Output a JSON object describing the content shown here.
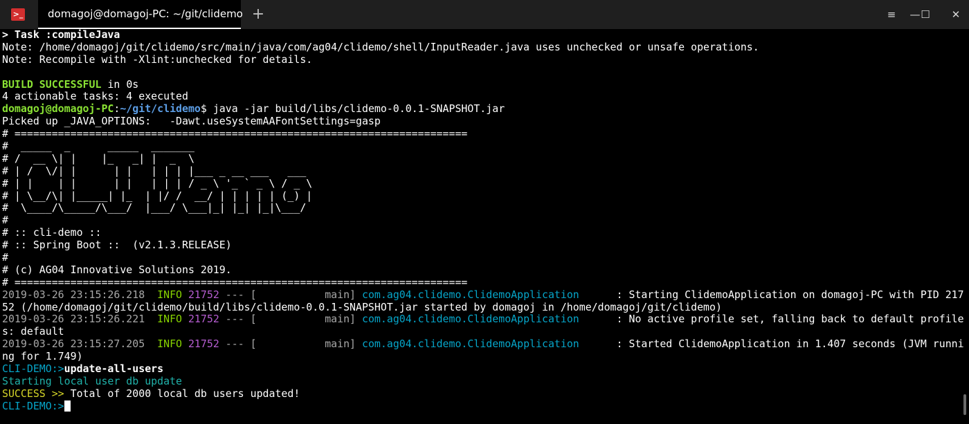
{
  "window": {
    "tab_title": "domagoj@domagoj-PC: ~/git/clidemo",
    "app_icon_glyph": ">_",
    "new_tab_glyph": "+",
    "controls": {
      "menu": "≡",
      "minimize": "—",
      "maximize": "☐",
      "close": "✕"
    }
  },
  "colors": {
    "default": "#ffffff",
    "green": "#8ae234",
    "blue": "#5c9ee6",
    "cyan": "#06a5c9",
    "grey": "#a8a8a8",
    "teal": "#20b2aa",
    "yellow": "#d5d528",
    "log_green": "#87d300",
    "pid_purple": "#b55dd0"
  },
  "terminal": {
    "lines": [
      [
        {
          "t": "> Task :compileJava",
          "c": "default",
          "b": true
        }
      ],
      [
        {
          "t": "Note: /home/domagoj/git/clidemo/src/main/java/com/ag04/clidemo/shell/InputReader.java uses unchecked or unsafe operations."
        }
      ],
      [
        {
          "t": "Note: Recompile with -Xlint:unchecked for details."
        }
      ],
      [
        {
          "t": ""
        }
      ],
      [
        {
          "t": "BUILD SUCCESSFUL",
          "c": "green",
          "b": true
        },
        {
          "t": " in 0s"
        }
      ],
      [
        {
          "t": "4 actionable tasks: 4 executed"
        }
      ],
      [
        {
          "t": "domagoj@domagoj-PC",
          "c": "green",
          "b": true
        },
        {
          "t": ":"
        },
        {
          "t": "~/git/clidemo",
          "c": "blue",
          "b": true
        },
        {
          "t": "$ java -jar build/libs/clidemo-0.0.1-SNAPSHOT.jar"
        }
      ],
      [
        {
          "t": "Picked up _JAVA_OPTIONS:   -Dawt.useSystemAAFontSettings=gasp"
        }
      ],
      [
        {
          "t": "# ========================================================================="
        }
      ],
      [
        {
          "t": "#  _____  _      _____  _______"
        }
      ],
      [
        {
          "t": "# /  __ \\| |    |_   _| |  _  \\"
        }
      ],
      [
        {
          "t": "# | /  \\/| |      | |   | | | |___ _ __ ___   ___"
        }
      ],
      [
        {
          "t": "# | |    | |      | |   | | | / _ \\ '_ ` _ \\ / _ \\"
        }
      ],
      [
        {
          "t": "# | \\__/\\| |_____| |_  | |/ /  __/ | | | | | (_) |"
        }
      ],
      [
        {
          "t": "#  \\____/\\_____/\\___/  |___/ \\___|_| |_| |_|\\___/"
        }
      ],
      [
        {
          "t": "#"
        }
      ],
      [
        {
          "t": "# :: cli-demo ::"
        }
      ],
      [
        {
          "t": "# :: Spring Boot ::  (v2.1.3.RELEASE)"
        }
      ],
      [
        {
          "t": "#"
        }
      ],
      [
        {
          "t": "# (c) AG04 Innovative Solutions 2019."
        }
      ],
      [
        {
          "t": "# ========================================================================="
        }
      ],
      [
        {
          "t": "2019-03-26 23:15:26.218",
          "c": "grey"
        },
        {
          "t": "  INFO",
          "c": "log_green"
        },
        {
          "t": " 21752",
          "c": "pid_purple"
        },
        {
          "t": " --- [           main]",
          "c": "grey"
        },
        {
          "t": " com.ag04.clidemo.ClidemoApplication",
          "c": "cyan"
        },
        {
          "t": "      : Starting ClidemoApplication on domagoj-PC with PID 217"
        }
      ],
      [
        {
          "t": "52 (/home/domagoj/git/clidemo/build/libs/clidemo-0.0.1-SNAPSHOT.jar started by domagoj in /home/domagoj/git/clidemo)"
        }
      ],
      [
        {
          "t": "2019-03-26 23:15:26.221",
          "c": "grey"
        },
        {
          "t": "  INFO",
          "c": "log_green"
        },
        {
          "t": " 21752",
          "c": "pid_purple"
        },
        {
          "t": " --- [           main]",
          "c": "grey"
        },
        {
          "t": " com.ag04.clidemo.ClidemoApplication",
          "c": "cyan"
        },
        {
          "t": "      : No active profile set, falling back to default profile"
        }
      ],
      [
        {
          "t": "s: default"
        }
      ],
      [
        {
          "t": "2019-03-26 23:15:27.205",
          "c": "grey"
        },
        {
          "t": "  INFO",
          "c": "log_green"
        },
        {
          "t": " 21752",
          "c": "pid_purple"
        },
        {
          "t": " --- [           main]",
          "c": "grey"
        },
        {
          "t": " com.ag04.clidemo.ClidemoApplication",
          "c": "cyan"
        },
        {
          "t": "      : Started ClidemoApplication in 1.407 seconds (JVM runni"
        }
      ],
      [
        {
          "t": "ng for 1.749)"
        }
      ],
      [
        {
          "t": "CLI-DEMO:>",
          "c": "cyan"
        },
        {
          "t": "update-all-users",
          "b": true
        }
      ],
      [
        {
          "t": "Starting local user db update",
          "c": "teal"
        }
      ],
      [
        {
          "t": "SUCCESS >>",
          "c": "yellow"
        },
        {
          "t": " Total of 2000 local db users updated!"
        }
      ],
      [
        {
          "t": "CLI-DEMO:>",
          "c": "cyan"
        },
        {
          "cursor": true
        }
      ]
    ]
  }
}
